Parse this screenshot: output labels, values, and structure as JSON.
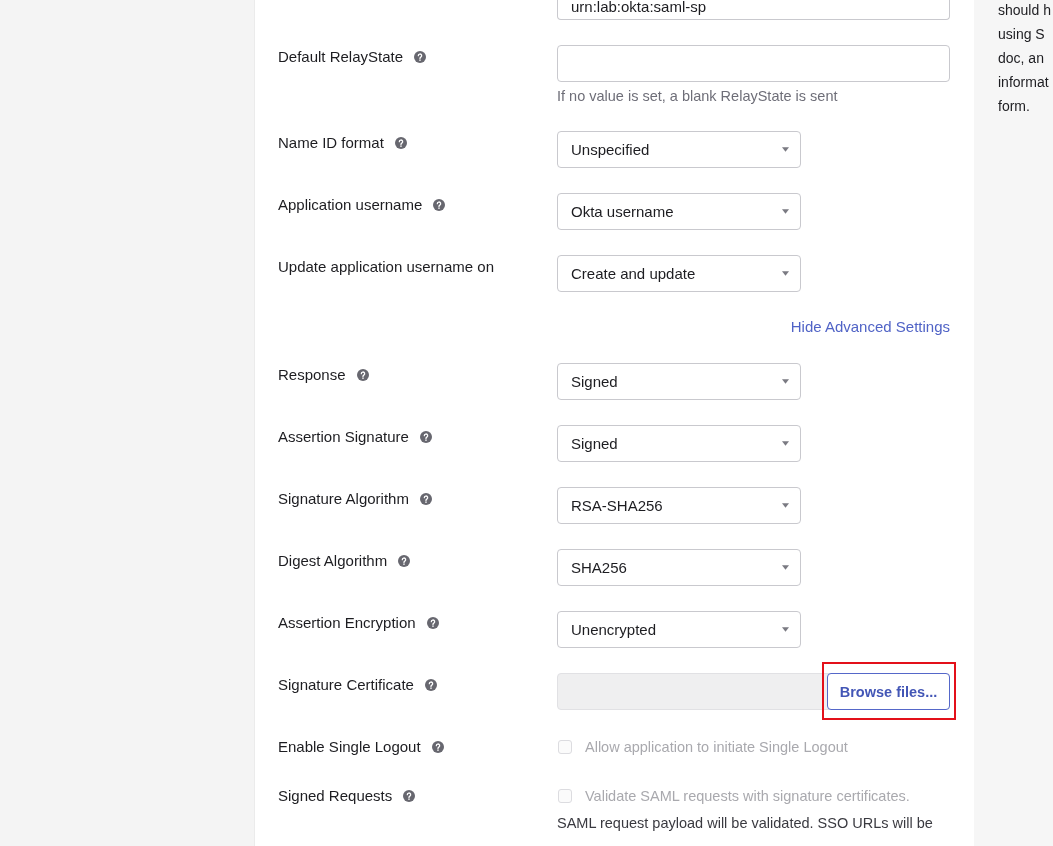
{
  "top_field": {
    "value": "urn:lab:okta:saml-sp"
  },
  "settings": [
    {
      "kind": "text",
      "label": "Default RelayState",
      "help": true,
      "hint": "If no value is set, a blank RelayState is sent"
    },
    {
      "kind": "select",
      "label": "Name ID format",
      "help": true,
      "value": "Unspecified"
    },
    {
      "kind": "select",
      "label": "Application username",
      "help": true,
      "value": "Okta username"
    },
    {
      "kind": "select",
      "label": "Update application username on",
      "help": false,
      "value": "Create and update"
    }
  ],
  "advanced_toggle": {
    "label": "Hide Advanced Settings"
  },
  "advanced_settings": [
    {
      "kind": "select",
      "label": "Response",
      "help": true,
      "value": "Signed"
    },
    {
      "kind": "select",
      "label": "Assertion Signature",
      "help": true,
      "value": "Signed"
    },
    {
      "kind": "select",
      "label": "Signature Algorithm",
      "help": true,
      "value": "RSA-SHA256"
    },
    {
      "kind": "select",
      "label": "Digest Algorithm",
      "help": true,
      "value": "SHA256"
    },
    {
      "kind": "select",
      "label": "Assertion Encryption",
      "help": true,
      "value": "Unencrypted"
    },
    {
      "kind": "file",
      "label": "Signature Certificate",
      "help": true,
      "button": "Browse files...",
      "highlighted": true
    },
    {
      "kind": "checkbox",
      "label": "Enable Single Logout",
      "help": true,
      "option": "Allow application to initiate Single Logout",
      "checked": false,
      "disabled": true
    },
    {
      "kind": "checkbox",
      "label": "Signed Requests",
      "help": true,
      "option": "Validate SAML requests with signature certificates.",
      "checked": false,
      "disabled": true,
      "note": "SAML request payload will be validated. SSO URLs will be"
    }
  ],
  "side_note": {
    "lines": [
      "should h",
      "using S",
      "doc, an",
      "informat",
      "form."
    ]
  }
}
